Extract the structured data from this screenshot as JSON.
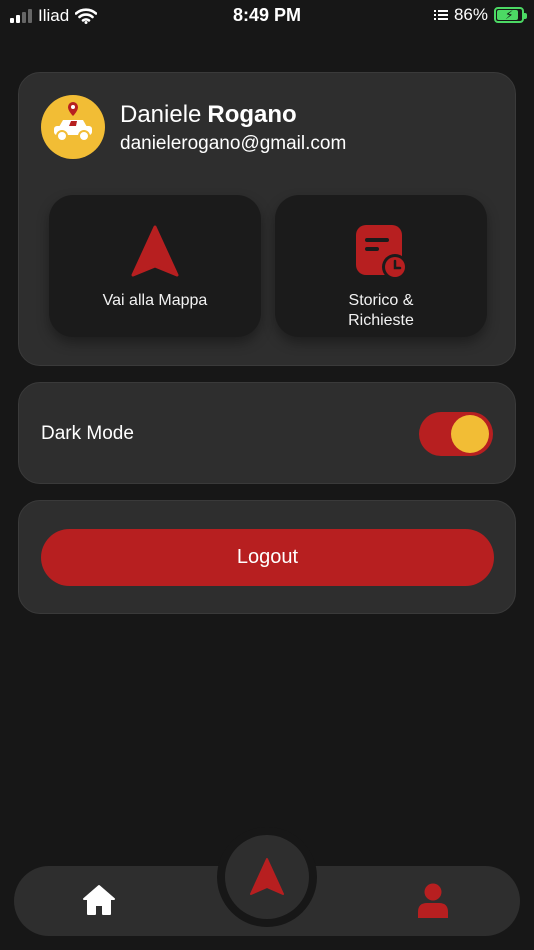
{
  "status_bar": {
    "carrier": "Iliad",
    "time": "8:49 PM",
    "battery": "86%",
    "battery_level": 0.86,
    "icons": [
      "signal-icon",
      "wifi-icon",
      "list-icon",
      "battery-charging-icon"
    ]
  },
  "profile": {
    "first_name": "Daniele",
    "last_name": "Rogano",
    "email": "danielerogano@gmail.com",
    "avatar_icon": "taxi-location-icon"
  },
  "actions": [
    {
      "label": "Vai alla Mappa",
      "icon": "navigation-arrow-icon"
    },
    {
      "label_line1": "Storico &",
      "label_line2": "Richieste",
      "icon": "history-document-icon"
    }
  ],
  "settings": {
    "dark_mode_label": "Dark Mode",
    "dark_mode_on": true
  },
  "logout_label": "Logout",
  "bottom_nav": {
    "items": [
      "home-icon",
      "navigation-arrow-icon",
      "profile-icon"
    ],
    "active": "profile"
  },
  "colors": {
    "background": "#171717",
    "card": "#2e2e2e",
    "tile": "#1b1b1b",
    "accent_red": "#b71f20",
    "accent_yellow": "#f2bd35",
    "battery_green": "#4cd964"
  }
}
